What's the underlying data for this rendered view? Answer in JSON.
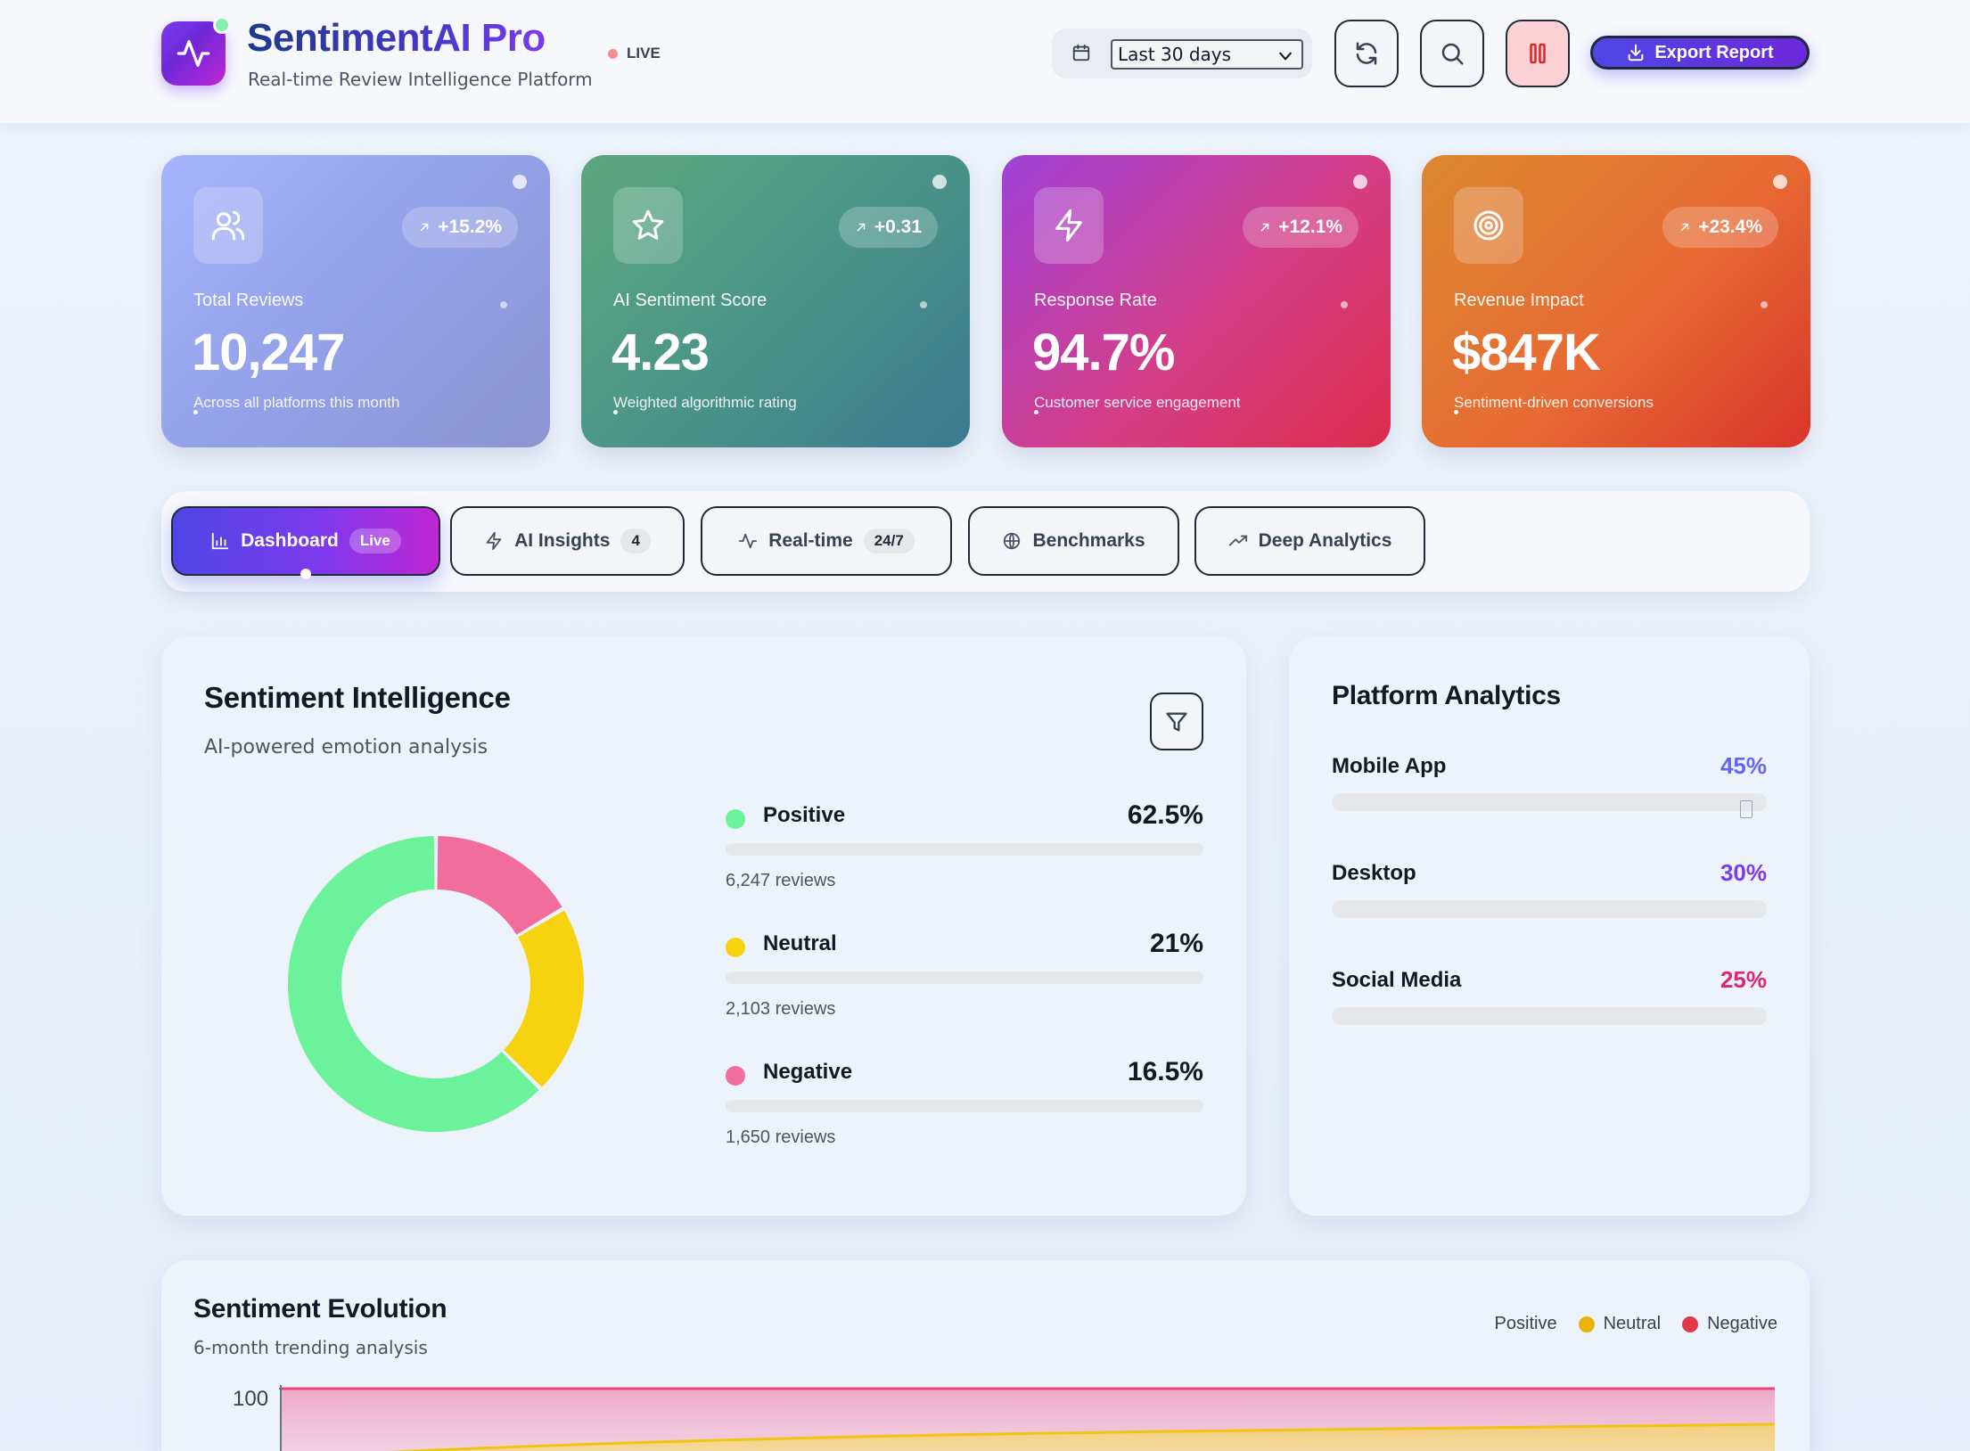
{
  "header": {
    "title": "SentimentAI Pro",
    "subtitle": "Real-time Review Intelligence Platform",
    "live_label": "LIVE",
    "date_range": "Last 30 days",
    "export_label": "Export Report"
  },
  "stats": [
    {
      "label": "Total Reviews",
      "value": "10,247",
      "trend": "+15.2%",
      "desc": "Across all platforms this month",
      "icon": "users-icon"
    },
    {
      "label": "AI Sentiment Score",
      "value": "4.23",
      "trend": "+0.31",
      "desc": "Weighted algorithmic rating",
      "icon": "star-icon"
    },
    {
      "label": "Response Rate",
      "value": "94.7%",
      "trend": "+12.1%",
      "desc": "Customer service engagement",
      "icon": "lightning-icon"
    },
    {
      "label": "Revenue Impact",
      "value": "$847K",
      "trend": "+23.4%",
      "desc": "Sentiment-driven conversions",
      "icon": "target-icon"
    }
  ],
  "tabs": [
    {
      "label": "Dashboard",
      "badge": "Live",
      "active": true
    },
    {
      "label": "AI Insights",
      "badge": "4"
    },
    {
      "label": "Real-time",
      "badge": "24/7"
    },
    {
      "label": "Benchmarks"
    },
    {
      "label": "Deep Analytics"
    }
  ],
  "sentiment": {
    "title": "Sentiment Intelligence",
    "subtitle": "AI-powered emotion analysis",
    "items": [
      {
        "name": "Positive",
        "pct": "62.5%",
        "count": "6,247 reviews",
        "value": 62.5,
        "color": "#6bf29a"
      },
      {
        "name": "Neutral",
        "pct": "21%",
        "count": "2,103 reviews",
        "value": 21,
        "color": "#f6d211"
      },
      {
        "name": "Negative",
        "pct": "16.5%",
        "count": "1,650 reviews",
        "value": 16.5,
        "color": "#f06d9c"
      }
    ]
  },
  "platform": {
    "title": "Platform Analytics",
    "items": [
      {
        "name": "Mobile App",
        "pct": "45%",
        "color": "#6366f1"
      },
      {
        "name": "Desktop",
        "pct": "30%",
        "color": "#7c3aed"
      },
      {
        "name": "Social Media",
        "pct": "25%",
        "color": "#db2777"
      }
    ]
  },
  "evolution": {
    "title": "Sentiment Evolution",
    "subtitle": "6-month trending analysis",
    "legend": [
      {
        "name": "Positive",
        "color": "#10b981"
      },
      {
        "name": "Neutral",
        "color": "#eab308"
      },
      {
        "name": "Negative",
        "color": "#e0394a"
      }
    ],
    "y_top_tick": "100"
  }
}
